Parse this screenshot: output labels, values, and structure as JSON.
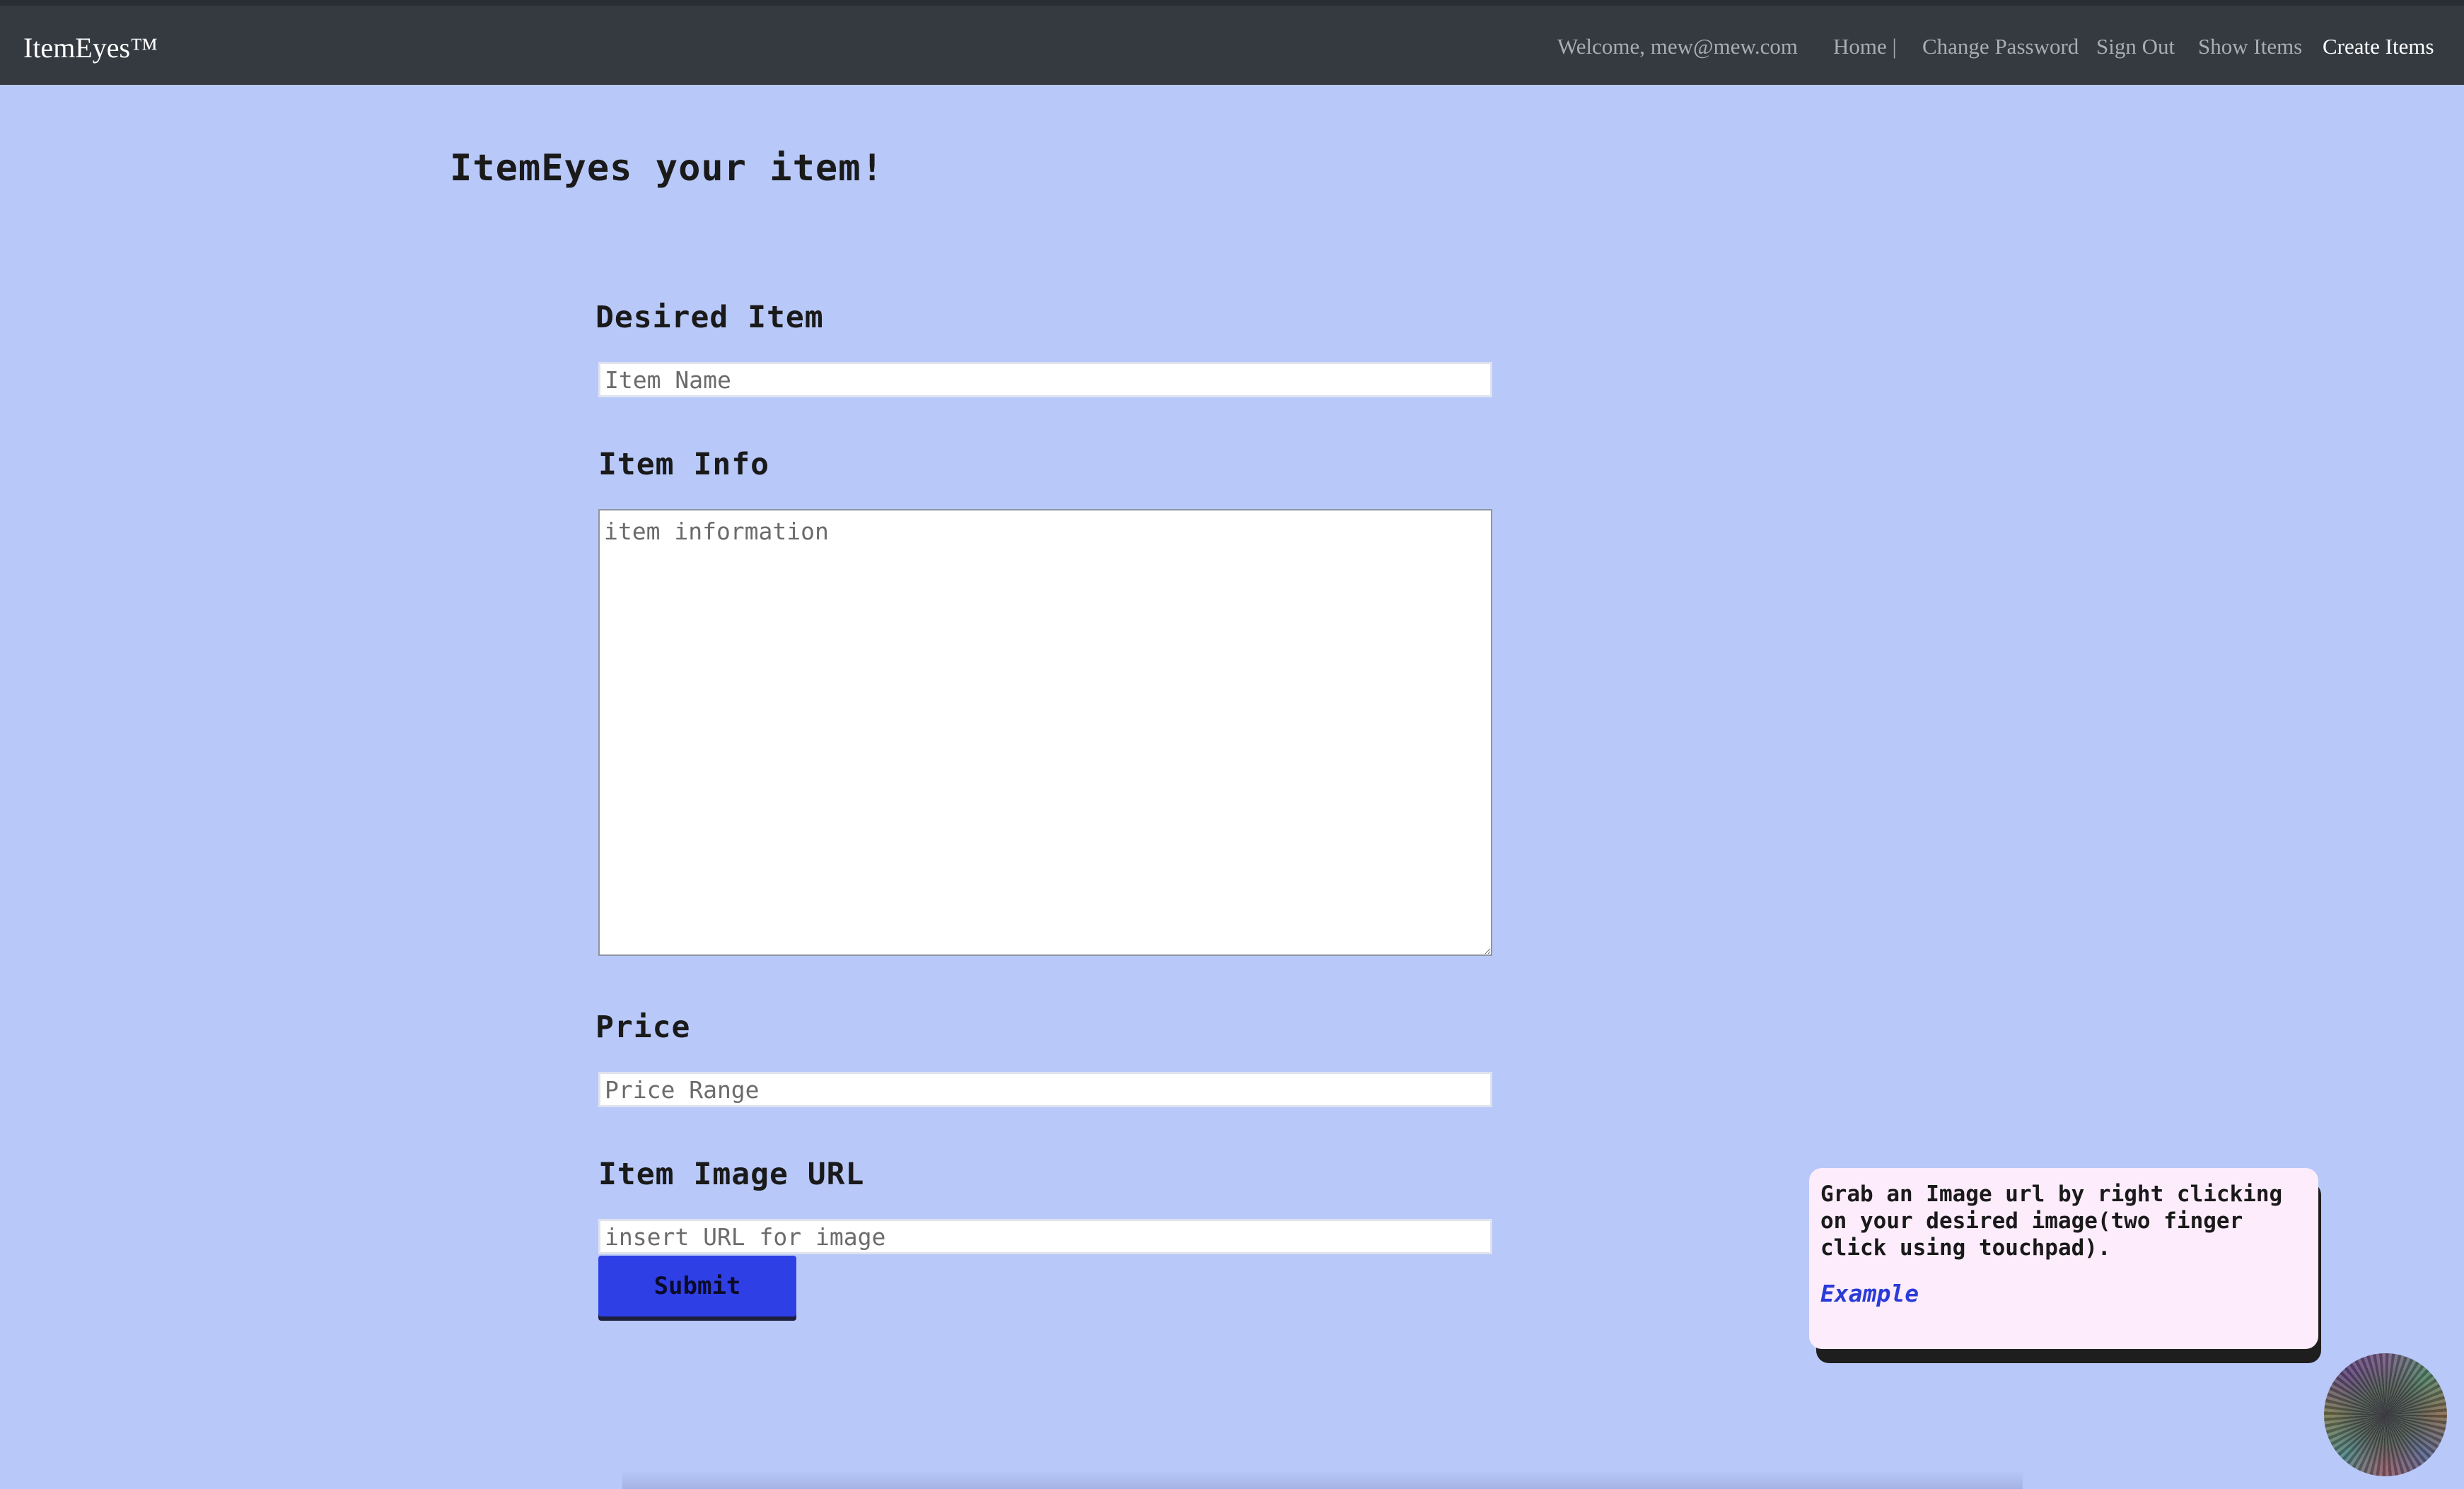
{
  "navbar": {
    "brand": "ItemEyes™",
    "welcome": "Welcome, mew@mew.com",
    "links": [
      {
        "label": "Home |"
      },
      {
        "label": "Change Password"
      },
      {
        "label": "Sign Out"
      },
      {
        "label": "Show Items"
      },
      {
        "label": "Create Items"
      }
    ]
  },
  "form": {
    "title": "ItemEyes your item!",
    "desired_item_label": "Desired Item",
    "desired_item_placeholder": "Item Name",
    "item_info_label": "Item Info",
    "item_info_placeholder": "item information",
    "price_label": "Price",
    "price_placeholder": "Price Range",
    "image_url_label": "Item Image URL",
    "image_url_placeholder": "insert URL for image",
    "submit_label": "Submit"
  },
  "tip": {
    "text": "Grab an Image url by right clicking on your desired image(two finger click using touchpad).",
    "link": "Example"
  },
  "colors": {
    "background": "#b8c8f8",
    "navbar": "#343a40",
    "submit": "#2f3fe6",
    "tip_card": "#fcecfc",
    "link": "#2a3bd6"
  }
}
